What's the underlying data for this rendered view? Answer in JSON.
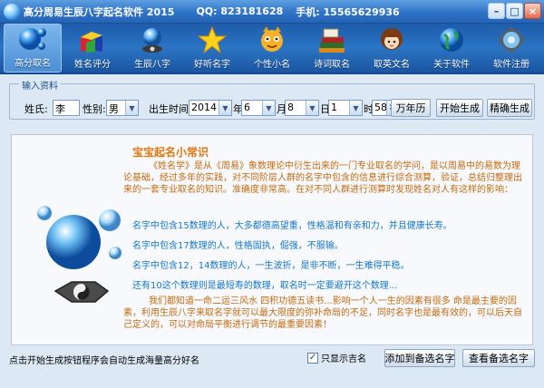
{
  "window": {
    "title": "高分周易生辰八字起名软件 2015",
    "qq": "QQ: 823181628",
    "phone": "手机: 15565629936",
    "minimize": "–",
    "maximize": "□",
    "close": "×"
  },
  "toolbar": {
    "items": [
      {
        "label": "高分取名",
        "icon": "blue-sphere-icon"
      },
      {
        "label": "姓名评分",
        "icon": "colored-blocks-icon"
      },
      {
        "label": "生辰八字",
        "icon": "taiji-sphere-icon"
      },
      {
        "label": "好听名字",
        "icon": "gold-star-icon"
      },
      {
        "label": "个性小名",
        "icon": "cartoon-cat-icon"
      },
      {
        "label": "诗词取名",
        "icon": "books-icon"
      },
      {
        "label": "取英文名",
        "icon": "girl-avatar-icon"
      },
      {
        "label": "关于软件",
        "icon": "globe-icon"
      },
      {
        "label": "软件注册",
        "icon": "gear-globe-icon"
      }
    ]
  },
  "inputs": {
    "group_label": "输入资料",
    "surname_label": "姓氏:",
    "surname_value": "李",
    "gender_label": "性别:",
    "gender_value": "男",
    "birth_label": "出生时间:",
    "year_value": "2014",
    "year_unit": "年",
    "month_value": "6",
    "month_unit": "月",
    "day_value": "8",
    "day_unit": "日",
    "hour_value": "1",
    "hour_unit": "时",
    "minute_value": "58",
    "minute_unit": "分",
    "calendar_button": "万年历",
    "generate_button": "开始生成",
    "precise_button": "精确生成"
  },
  "panel": {
    "title": "宝宝起名小常识",
    "intro": "《姓名学》是从《周易》象数理论中衍生出来的一门专业取名的学问，是以周易中的易数为理论基础，经过多年的实践，对不同阶层人群的名字中包含的信息进行综合测算，验证，总结归整理出来的一套专业取名的知识。准确度非常高。在对不同人群进行测算时发现姓名对人有这样的影响：",
    "tips": [
      "名字中包含15数理的人，大多都德高望重，性格温和有亲和力，并且健康长寿。",
      "名字中包含17数理的人，性格固执，倔强，不服输。",
      "名字中包含12，14数理的人，一生波折，是非不断，一生难得平稳。",
      "还有10这个数理则是最短寿的数理，取名时一定要避开这个数理..."
    ],
    "outro": "我们都知道一命二运三风水 四积功德五读书...影响一个人一生的因素有很多 命是最主要的因素，利用生辰八字来取名字就可以最大限度的弥补命局的不足，同时名字也是最有效的，可以后天自己定义的，可以对命局平衡进行调节的最重要因素！"
  },
  "status": {
    "hint": "点击开始生成按钮程序会自动生成海量高分好名",
    "only_good_label": "只显示吉名",
    "only_good_checked": true,
    "add_button": "添加到备选名字",
    "view_button": "查看备选名字"
  }
}
